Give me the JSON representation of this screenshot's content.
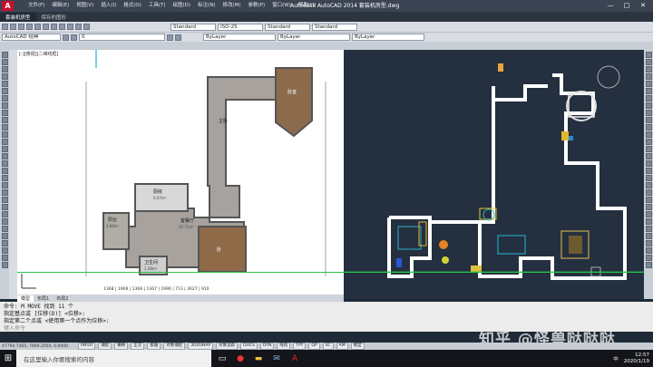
{
  "app": {
    "logo_letter": "A",
    "window_title": "Autodesk AutoCAD 2014  套装机房型.dwg",
    "menu": [
      "文件(F)",
      "编辑(E)",
      "视图(V)",
      "插入(I)",
      "格式(O)",
      "工具(T)",
      "绘图(D)",
      "标注(N)",
      "修改(M)",
      "参数(P)",
      "窗口(W)",
      "帮助(H)"
    ],
    "win_btns": [
      "—",
      "□",
      "✕"
    ]
  },
  "doc_tabs": [
    "套装机房型",
    "保存的图形"
  ],
  "toolbar": {
    "workspace": "AutoCAD 经典",
    "layer": "0",
    "text_style": "Standard",
    "dim_style": "ISO-25",
    "table_style": "Standard",
    "mleader_style": "Standard",
    "color": "ByLayer",
    "linetype": "ByLayer",
    "lineweight": "ByLayer"
  },
  "viewport": {
    "label": "[-][俯视][二维线框]",
    "room_labels": {
      "main_bedroom": "主卧",
      "kitchen": "厨房",
      "living": "客餐厅",
      "balcony": "阳台",
      "bathroom": "卫生间",
      "bedroom_area": "卧",
      "room_tr": "卧室"
    },
    "room_sizes": {
      "kitchen": "6.07m²",
      "living": "37.71m²",
      "balcony": "3.66m²",
      "bathroom": "1.58m²"
    },
    "dims_text": "1368 | 1908 | 1368 | 1367 | 1996 | 713 | 3627 | 910",
    "layout_tabs": [
      "模型",
      "布局1",
      "布局2"
    ]
  },
  "command": {
    "lines": [
      "命令: M MOVE 找到 11 个",
      "指定基点或 [位移(D)] <位移>:",
      "指定第二个点或 <使用第一个点作为位移>:"
    ],
    "placeholder": "键入命令"
  },
  "status": {
    "coords": "47794.7465, 7669.2050, 0.0000",
    "buttons": [
      "INFER",
      "捕捉",
      "栅格",
      "正交",
      "极轴",
      "对象捕捉",
      "3DOSNAP",
      "对象追踪",
      "DUCS",
      "DYN",
      "线宽",
      "TPY",
      "QP",
      "SC",
      "AM"
    ],
    "model": "模型"
  },
  "taskbar": {
    "search_placeholder": "在这里输入你要搜索的内容",
    "time": "12:57",
    "date": "2020/1/19",
    "ime": "中"
  },
  "watermark": "知乎 @怪兽哒哒哒"
}
